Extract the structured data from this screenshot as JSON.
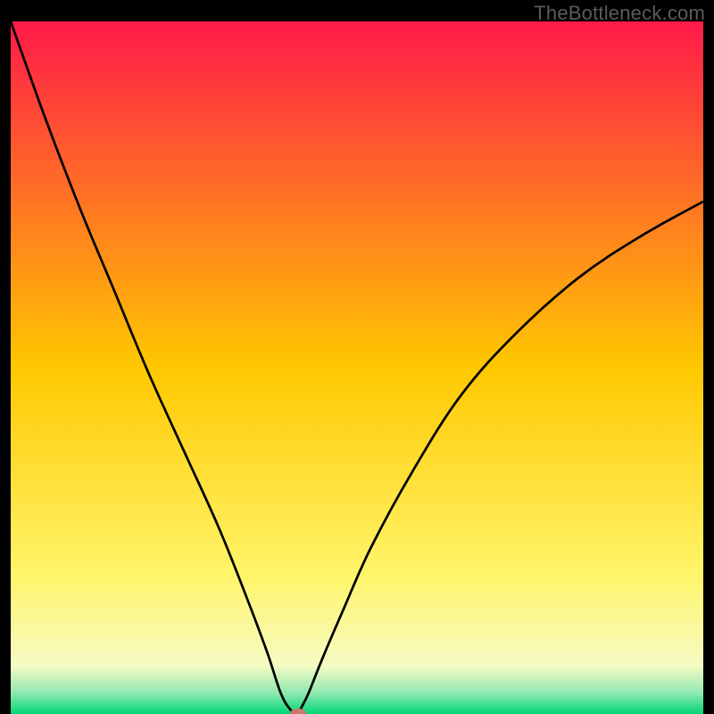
{
  "watermark": "TheBottleneck.com",
  "chart_data": {
    "type": "line",
    "title": "",
    "xlabel": "",
    "ylabel": "",
    "xlim": [
      0,
      100
    ],
    "ylim": [
      0,
      100
    ],
    "grid": false,
    "background_gradient": {
      "stops": [
        {
          "offset": 0.0,
          "color": "#ff1a49"
        },
        {
          "offset": 0.5,
          "color": "#ffc800"
        },
        {
          "offset": 0.8,
          "color": "#fff56a"
        },
        {
          "offset": 0.93,
          "color": "#f6fbc3"
        },
        {
          "offset": 0.97,
          "color": "#8fe9b1"
        },
        {
          "offset": 1.0,
          "color": "#00d676"
        }
      ]
    },
    "series": [
      {
        "name": "bottleneck-curve",
        "color": "#000000",
        "x": [
          0,
          5,
          10,
          15,
          20,
          25,
          30,
          34,
          37,
          39,
          40.5,
          41.5,
          42,
          43,
          45,
          48,
          52,
          58,
          65,
          73,
          82,
          91,
          100
        ],
        "y": [
          100,
          86,
          73,
          61,
          49,
          38,
          27,
          17,
          9,
          3,
          0.5,
          0,
          1,
          3,
          8,
          15,
          24,
          35,
          46,
          55,
          63,
          69,
          74
        ]
      }
    ],
    "marker": {
      "name": "optimal-point",
      "x": 41.5,
      "y": 0,
      "rx": 1.2,
      "ry": 0.8,
      "fill": "#c77a6d"
    }
  }
}
